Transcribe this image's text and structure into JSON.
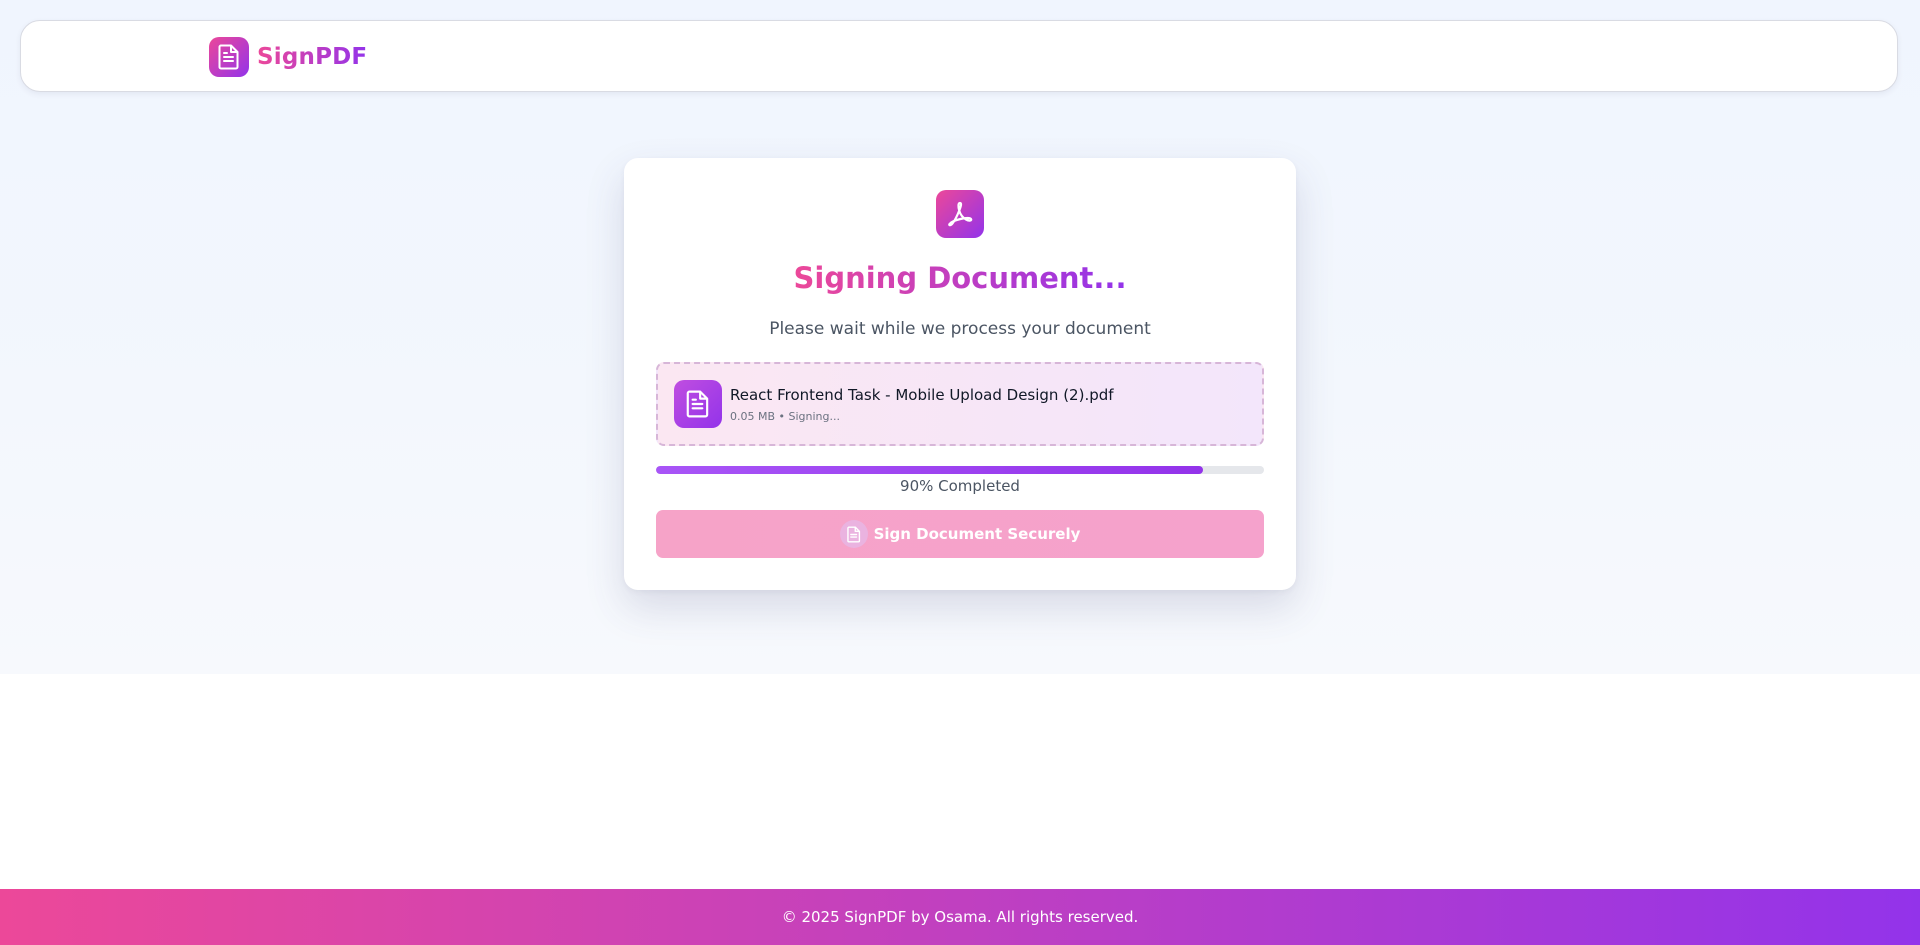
{
  "header": {
    "brand_name": "SignPDF",
    "brand_icon": "document-icon"
  },
  "card": {
    "badge_icon": "pdf-icon",
    "title": "Signing Document...",
    "subtitle": "Please wait while we process your document",
    "file": {
      "icon": "document-icon",
      "name": "React Frontend Task - Mobile Upload Design (2).pdf",
      "meta": "0.05 MB • Signing..."
    },
    "progress": {
      "value": 90,
      "label": "90% Completed"
    },
    "sign_button": {
      "label": "Sign Document Securely",
      "icon": "document-icon"
    }
  },
  "footer": {
    "text": "© 2025 SignPDF by Osama. All rights reserved."
  },
  "colors": {
    "brand_pink": "#ec4899",
    "brand_purple": "#9333ea",
    "progress_fill": "#a855f7",
    "button_disabled": "#f5a3c9"
  }
}
